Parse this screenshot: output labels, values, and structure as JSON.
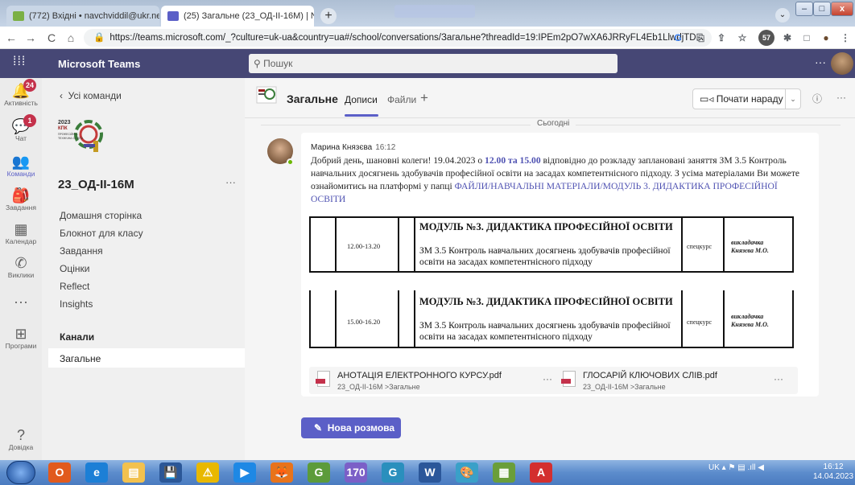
{
  "browser": {
    "tabs": [
      {
        "label": "(772) Вхідні • navchviddil@ukr.ne"
      },
      {
        "label": "(25) Загальне (23_ОД-ІІ-16М) | N"
      }
    ],
    "tab_close": "×",
    "new_tab": "+",
    "window_buttons": {
      "minimize": "–",
      "maximize": "□",
      "close": "x"
    },
    "tabs_dropdown": "⌄",
    "nav": {
      "back": "←",
      "forward": "→",
      "reload": "C",
      "home": "⌂"
    },
    "url": "https://teams.microsoft.com/_?culture=uk-ua&country=ua#/school/conversations/Загальне?threadId=19:IPEm2pO7wXA6JRRyFL4Eb1LlwdjTD...",
    "extensions": [
      "G",
      "⎘",
      "⇪",
      "☆",
      "57",
      "✱",
      "□",
      "●",
      "⋮"
    ]
  },
  "teams": {
    "app_name": "Microsoft Teams",
    "search_placeholder": "Пошук",
    "top_more": "···"
  },
  "rail": [
    {
      "label": "Активність",
      "icon": "bell-icon",
      "glyph": "🔔",
      "badge": "24"
    },
    {
      "label": "Чат",
      "icon": "chat-icon",
      "glyph": "💬",
      "badge": "1"
    },
    {
      "label": "Команди",
      "icon": "teams-icon",
      "glyph": "👥",
      "active": true
    },
    {
      "label": "Завдання",
      "icon": "assignments-icon",
      "glyph": "🎒"
    },
    {
      "label": "Календар",
      "icon": "calendar-icon",
      "glyph": "▦"
    },
    {
      "label": "Виклики",
      "icon": "phone-icon",
      "glyph": "✆"
    },
    {
      "label": "",
      "icon": "more-icon",
      "glyph": "···"
    },
    {
      "label": "Програми",
      "icon": "apps-icon",
      "glyph": "⊞"
    }
  ],
  "rail_help": {
    "label": "Довідка",
    "glyph": "?"
  },
  "left_panel": {
    "back_label": "Усі команди",
    "team_name": "23_ОД-ІІ-16М",
    "team_more": "···",
    "logo_text": [
      "2023",
      "КПК",
      "ПРОФЕСІЙНО-",
      "ТЕХНІЧНА ОСВІТА"
    ],
    "nav_items": [
      "Домашня сторінка",
      "Блокнот для класу",
      "Завдання",
      "Оцінки",
      "Reflect",
      "Insights"
    ],
    "channels_header": "Канали",
    "channels": [
      "Загальне"
    ]
  },
  "header": {
    "channel_name": "Загальне",
    "tab_posts": "Дописи",
    "tab_files": "Файли",
    "tab_add": "+",
    "meet_button": "Почати нараду",
    "meet_dropdown": "⌄",
    "info": "ⓘ",
    "more": "···"
  },
  "conversation": {
    "date_separator": "Сьогодні",
    "message": {
      "author": "Марина Князєва",
      "time": "16:12",
      "text_part1": "Добрий день, шановні колеги! 19.04.2023 о ",
      "text_highlight": "12.00 та 15.00",
      "text_part2": " відповідно до розкладу заплановані заняття ЗМ 3.5 Контроль навчальних досягнень здобувачів професійної освіти на засадах компетентнісного підходу. З усіма матеріалами Ви можете ознайомитись на платформі у папці ",
      "text_link": "ФАЙЛИ/НАВЧАЛЬНІ МАТЕРІАЛИ/МОДУЛЬ 3. ДИДАКТИКА ПРОФЕСІЙНОЇ ОСВІТИ"
    },
    "schedule": [
      {
        "time": "12.00-13.20",
        "module": "МОДУЛЬ №3. ДИДАКТИКА ПРОФЕСІЙНОЇ ОСВІТИ",
        "topic": "ЗМ 3.5 Контроль навчальних досягнень здобувачів професійної освіти на засадах компетентнісного підходу",
        "type": "спецкурс",
        "teacher_role": "викладачка",
        "teacher": "Князєва М.О."
      },
      {
        "time": "15.00-16.20",
        "module": "МОДУЛЬ №3. ДИДАКТИКА ПРОФЕСІЙНОЇ ОСВІТИ",
        "topic": "ЗМ 3.5 Контроль навчальних досягнень здобувачів професійної освіти на засадах компетентнісного підходу",
        "type": "спецкурс",
        "teacher_role": "викладачка",
        "teacher": "Князєва М.О."
      }
    ],
    "attachments": [
      {
        "name": "АНОТАЦІЯ ЕЛЕКТРОННОГО КУРСУ.pdf",
        "path": "23_ОД-ІІ-16М >Загальне",
        "more": "···"
      },
      {
        "name": "ГЛОСАРІЙ КЛЮЧОВИХ СЛІВ.pdf",
        "path": "23_ОД-ІІ-16М >Загальне",
        "more": "···"
      }
    ],
    "new_conversation": "Нова розмова"
  },
  "taskbar": {
    "icons": [
      "O",
      "e",
      "▤",
      "💾",
      "⚠",
      "▶",
      "🦊",
      "G",
      "170",
      "G",
      "W",
      "🎨",
      "▦",
      "A"
    ],
    "tray": "UK  ▴  ⚑  ▤  .ıll  ◀",
    "time": "16:12",
    "date": "14.04.2023"
  },
  "colors": {
    "teams_purple": "#464775",
    "accent": "#5b5fc7",
    "badge_red": "#c4314b"
  }
}
